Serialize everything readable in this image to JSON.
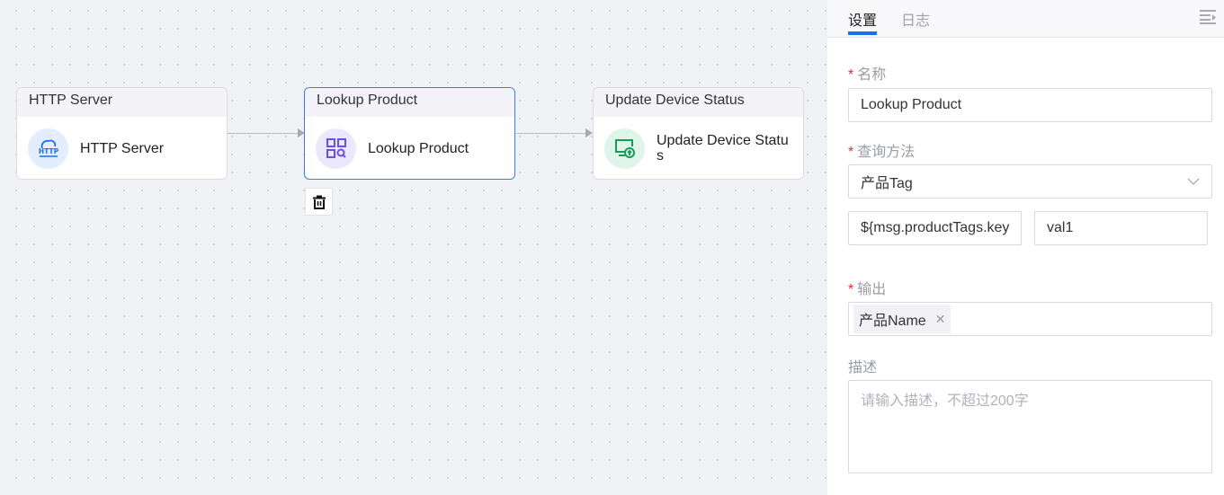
{
  "canvas": {
    "nodes": [
      {
        "header": "HTTP Server",
        "label": "HTTP Server",
        "icon": "http-cloud-icon",
        "icon_color": "#1a6ff0",
        "icon_bg": "#e3edfd"
      },
      {
        "header": "Lookup Product",
        "label": "Lookup Product",
        "icon": "grid-search-icon",
        "icon_color": "#6a4ee8",
        "icon_bg": "#ece8fc"
      },
      {
        "header": "Update Device Status",
        "label": "Update Device Status",
        "icon": "device-upload-icon",
        "icon_color": "#1a9a5a",
        "icon_bg": "#dff5ea"
      }
    ],
    "selected_node": "Lookup Product",
    "delete_icon": "trash-icon"
  },
  "panel": {
    "tabs": [
      {
        "label": "设置",
        "active": true
      },
      {
        "label": "日志",
        "active": false
      }
    ],
    "accent": "#1a6ff0",
    "fields": {
      "name_label": "名称",
      "name_value": "Lookup Product",
      "method_label": "查询方法",
      "method_value": "产品Tag",
      "key_value": "${msg.productTags.key",
      "val_value": "val1",
      "output_label": "输出",
      "output_tags": [
        "产品Name"
      ],
      "desc_label": "描述",
      "desc_placeholder": "请输入描述，不超过200字"
    },
    "required_mark": "*"
  }
}
